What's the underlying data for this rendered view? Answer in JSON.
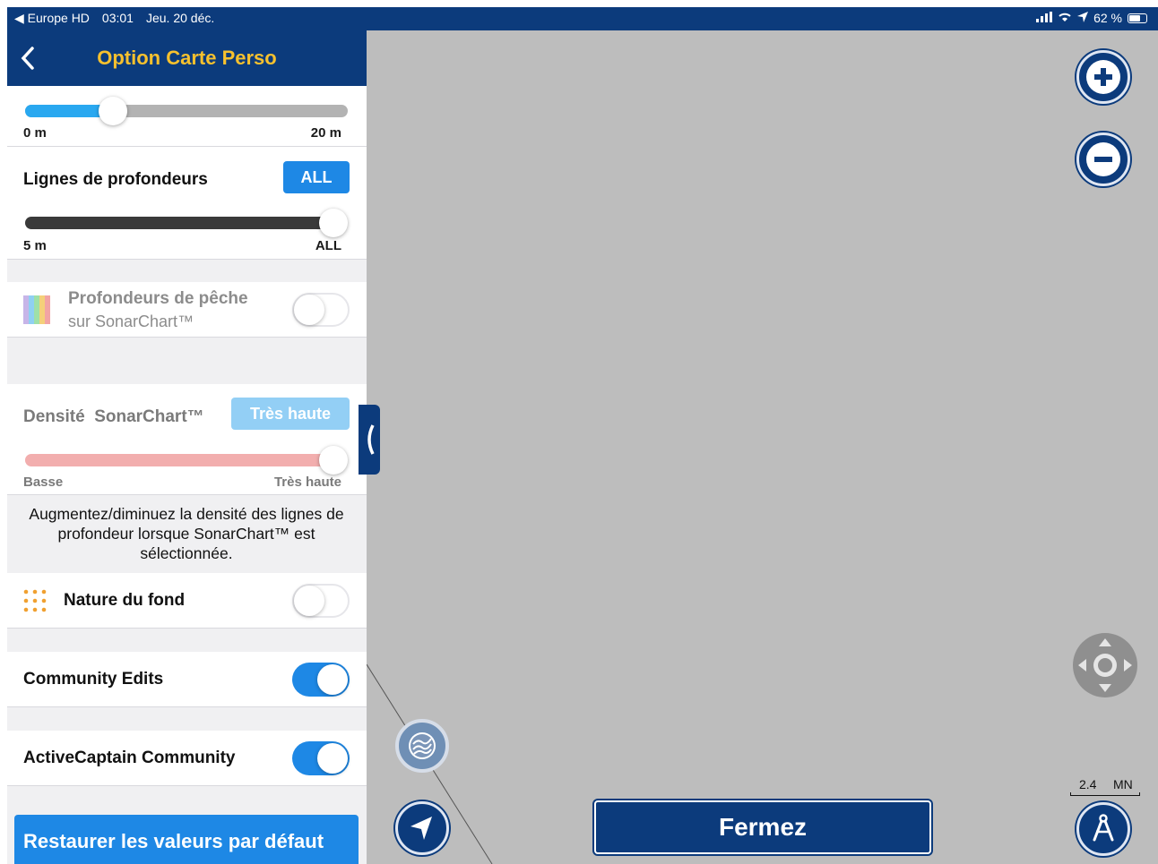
{
  "status_bar": {
    "back_app": "◀ Europe HD",
    "time": "03:01",
    "date": "Jeu. 20 déc.",
    "battery": "62 %"
  },
  "nav": {
    "title": "Option Carte Perso",
    "back_icon": "chevron-left-icon"
  },
  "shading_slider": {
    "min_label": "0 m",
    "max_label": "20 m",
    "value_fraction": 0.27,
    "color": "#29a8f0"
  },
  "depth_lines": {
    "label": "Lignes de profondeurs",
    "chip": "ALL",
    "min_label": "5 m",
    "max_label": "ALL",
    "value_fraction": 1.0
  },
  "fishing_depths": {
    "title": "Profondeurs de pêche",
    "subtitle": "sur SonarChart™",
    "toggle_on": false
  },
  "sonar_density": {
    "label": "Densité  SonarChart™",
    "chip": "Très haute",
    "min_label": "Basse",
    "max_label": "Très haute",
    "value_fraction": 1.0,
    "description": "Augmentez/diminuez la densité des lignes de profondeur lorsque  SonarChart™ est sélectionnée."
  },
  "bottom_nature": {
    "label": "Nature du fond",
    "toggle_on": false
  },
  "community_edits": {
    "label": "Community Edits",
    "toggle_on": true
  },
  "activecaptain": {
    "label": "ActiveCaptain Community",
    "toggle_on": true
  },
  "restore_button": "Restaurer les valeurs par défaut",
  "map": {
    "zoom_in_icon": "plus-icon",
    "zoom_out_icon": "minus-icon",
    "pan_icon": "directional-pad-icon",
    "layers_icon": "sonar-layer-icon",
    "locate_icon": "navigation-arrow-icon",
    "compass_icon": "compass-icon",
    "close_button": "Fermez",
    "scale_value": "2.4",
    "scale_unit": "MN"
  },
  "colors": {
    "brand_navy": "#0c3b7c",
    "title_yellow": "#f7c12e",
    "accent_blue": "#1e88e5"
  }
}
